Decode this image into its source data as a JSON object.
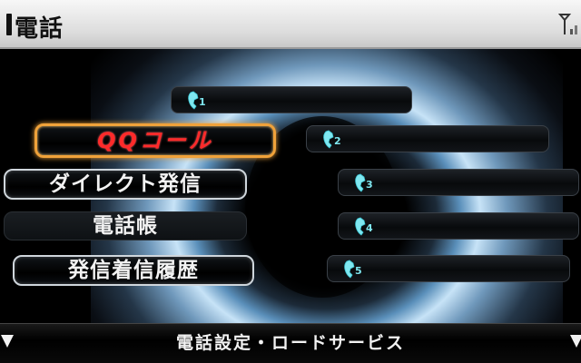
{
  "header": {
    "title": "電話",
    "signal_icon": "antenna-signal-icon"
  },
  "menu": {
    "qq_call": "QQコール",
    "direct_dial": "ダイレクト発信",
    "phonebook": "電話帳",
    "call_history": "発信着信履歴"
  },
  "speed_dial": [
    {
      "number": "1",
      "icon": "phone-handset-icon",
      "name": ""
    },
    {
      "number": "2",
      "icon": "phone-handset-icon",
      "name": ""
    },
    {
      "number": "3",
      "icon": "phone-handset-icon",
      "name": ""
    },
    {
      "number": "4",
      "icon": "phone-handset-icon",
      "name": ""
    },
    {
      "number": "5",
      "icon": "phone-handset-icon",
      "name": ""
    }
  ],
  "footer": {
    "title": "電話設定・ロードサービス",
    "left_icon": "scroll-down-icon",
    "right_icon": "scroll-down-icon"
  },
  "colors": {
    "header_bg": "#e6e6e6",
    "qq_border": "#f0a23a",
    "qq_text": "#ff2a2a",
    "slot_number": "#7fe7f0",
    "glow": "#c7e3f7"
  }
}
